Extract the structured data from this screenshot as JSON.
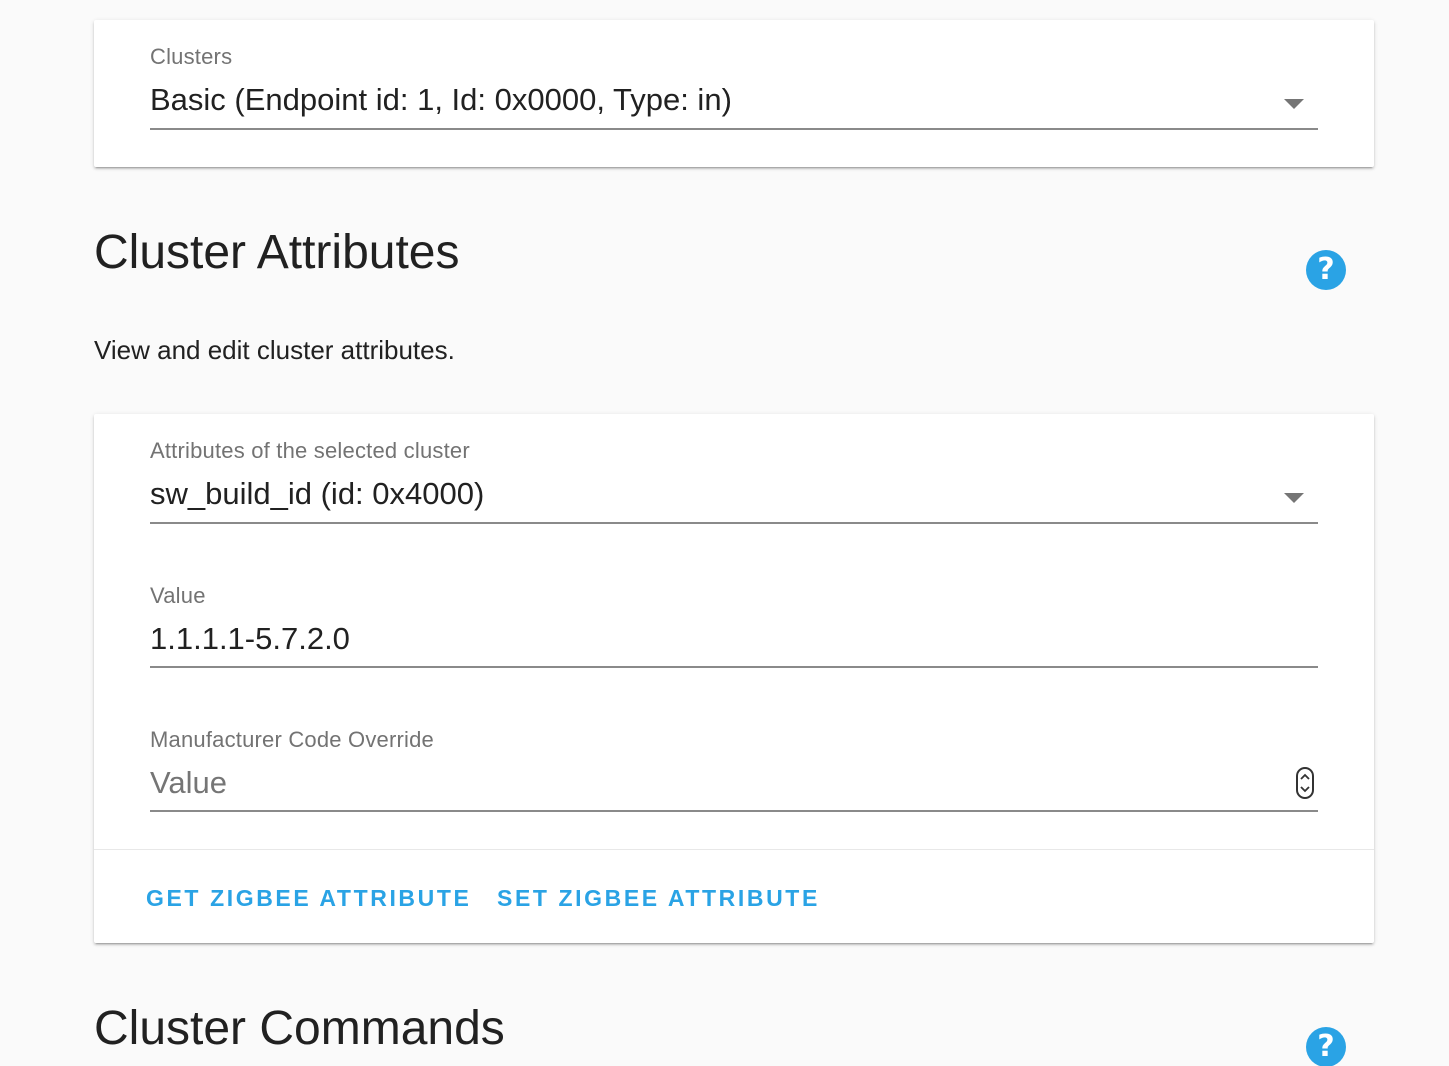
{
  "clusters_card": {
    "label": "Clusters",
    "selected": "Basic (Endpoint id: 1, Id: 0x0000, Type: in)"
  },
  "cluster_attributes": {
    "title": "Cluster Attributes",
    "description": "View and edit cluster attributes.",
    "attribute_select": {
      "label": "Attributes of the selected cluster",
      "selected": "sw_build_id (id: 0x4000)"
    },
    "value_field": {
      "label": "Value",
      "value": "1.1.1.1-5.7.2.0"
    },
    "manufacturer_field": {
      "label": "Manufacturer Code Override",
      "placeholder": "Value"
    },
    "actions": {
      "get": "GET ZIGBEE ATTRIBUTE",
      "set": "SET ZIGBEE ATTRIBUTE"
    }
  },
  "cluster_commands": {
    "title": "Cluster Commands"
  },
  "icons": {
    "help": "help-circle-icon",
    "dropdown": "arrow-drop-down-icon",
    "spinner": "number-spinner-icon"
  },
  "colors": {
    "accent": "#2aa3e5",
    "background": "#fafafa",
    "card": "#ffffff"
  }
}
